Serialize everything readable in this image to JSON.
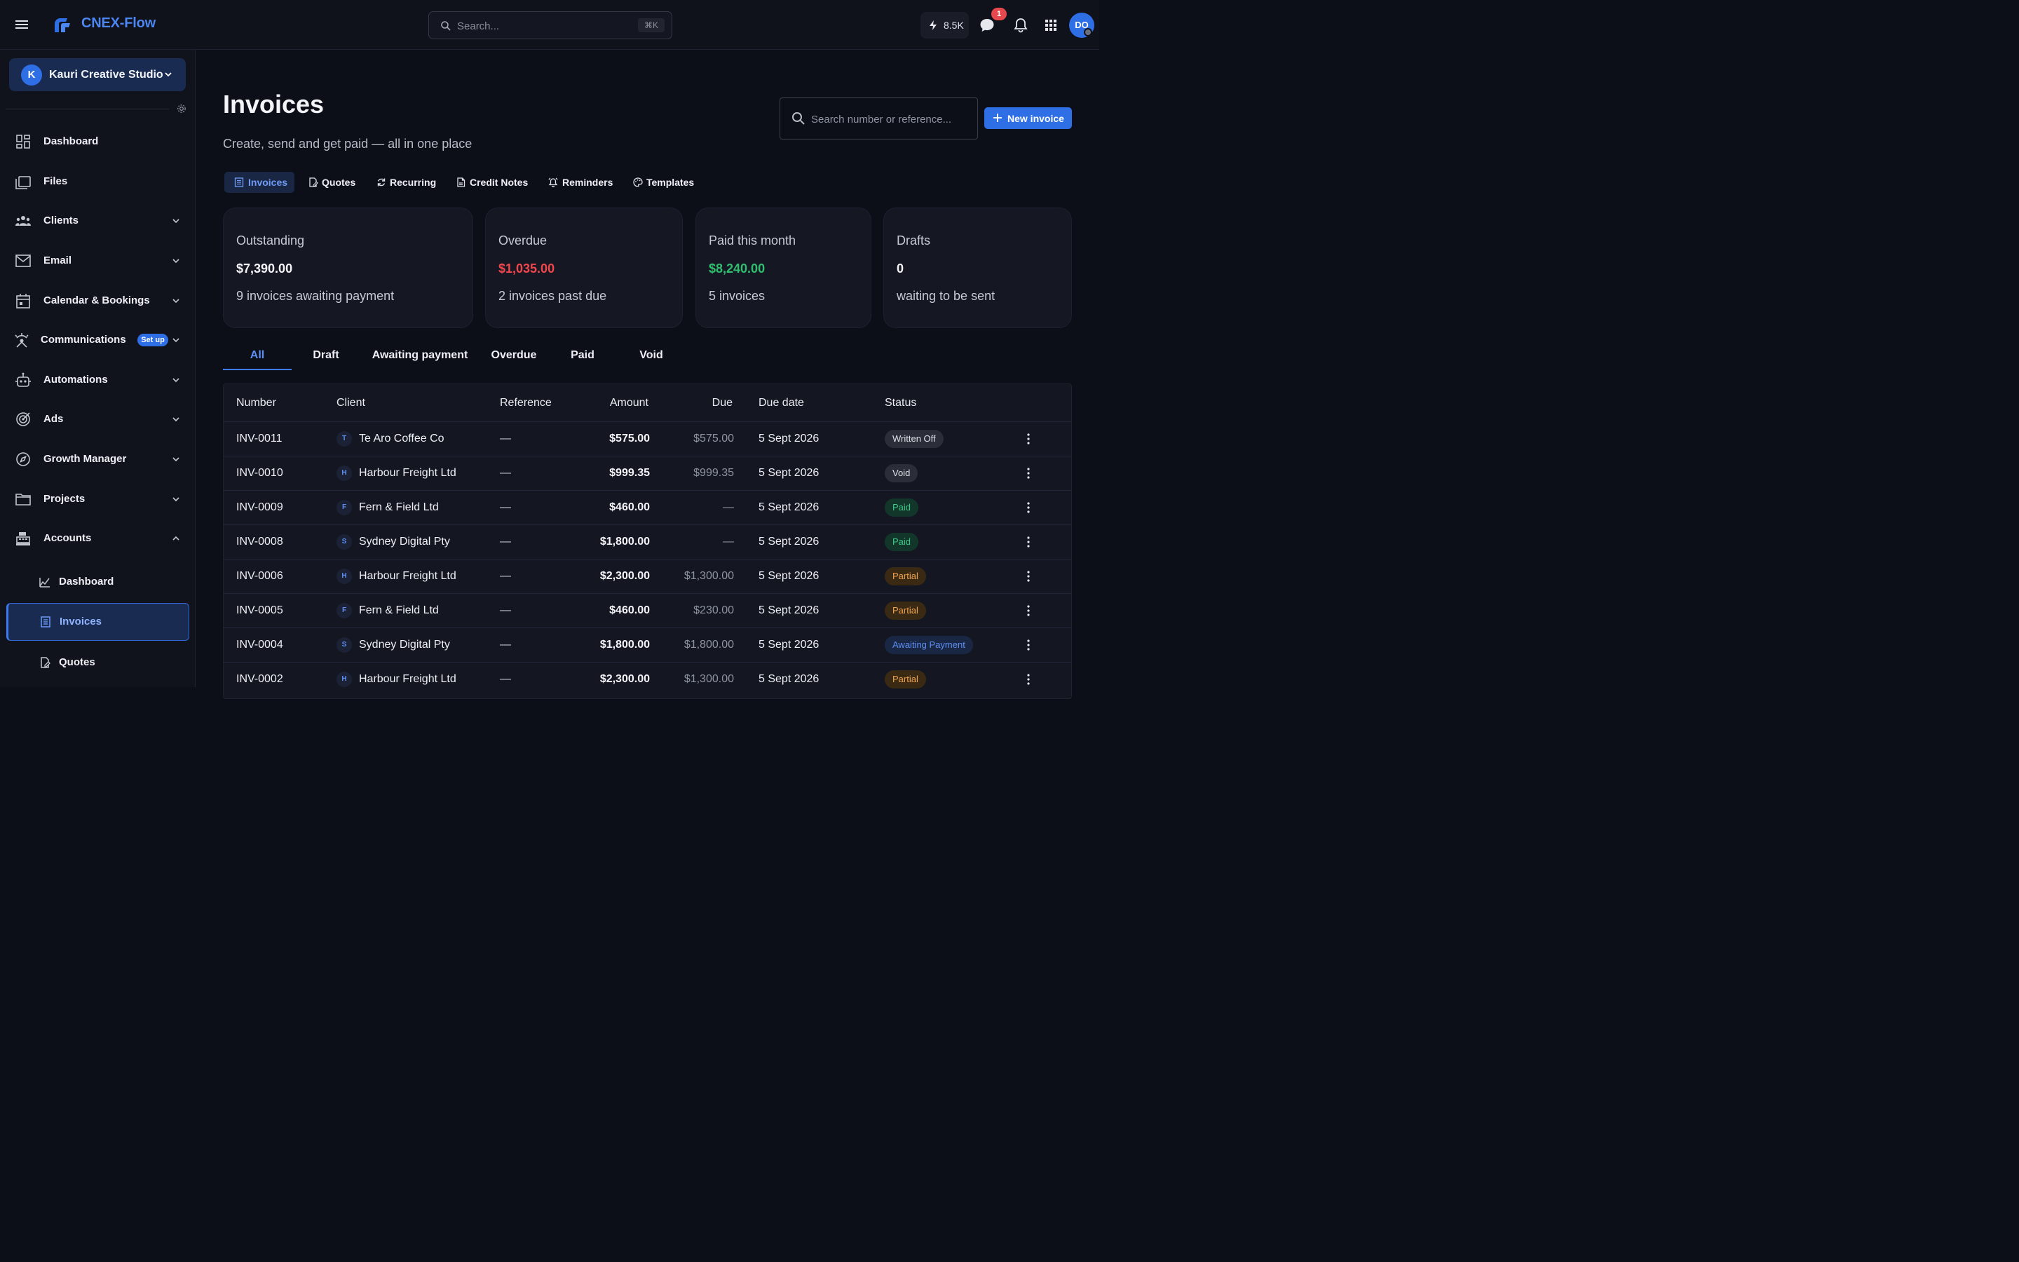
{
  "app": {
    "brand": "CNEX-Flow"
  },
  "topbar": {
    "search_placeholder": "Search...",
    "search_shortcut": "⌘K",
    "credits": "8.5K",
    "messages_badge": "1",
    "avatar_initials": "DO"
  },
  "sidebar": {
    "org_initial": "K",
    "org_name": "Kauri Creative Studio",
    "items": [
      {
        "label": "Dashboard",
        "icon": "dashboard-icon"
      },
      {
        "label": "Files",
        "icon": "files-icon"
      },
      {
        "label": "Clients",
        "icon": "clients-icon"
      },
      {
        "label": "Email",
        "icon": "email-icon"
      },
      {
        "label": "Calendar & Bookings",
        "icon": "calendar-icon"
      },
      {
        "label": "Communications",
        "icon": "communications-icon",
        "badge": "Set up"
      },
      {
        "label": "Automations",
        "icon": "robot-icon"
      },
      {
        "label": "Ads",
        "icon": "target-icon"
      },
      {
        "label": "Growth Manager",
        "icon": "compass-icon"
      },
      {
        "label": "Projects",
        "icon": "folder-icon"
      },
      {
        "label": "Accounts",
        "icon": "register-icon"
      }
    ],
    "sub_items": [
      {
        "label": "Dashboard",
        "icon": "chart-icon"
      },
      {
        "label": "Invoices",
        "icon": "invoice-icon"
      },
      {
        "label": "Quotes",
        "icon": "quote-icon"
      }
    ]
  },
  "page": {
    "title": "Invoices",
    "subtitle": "Create, send and get paid — all in one place",
    "search_placeholder": "Search number or reference...",
    "new_button": "New invoice"
  },
  "subnav": [
    "Invoices",
    "Quotes",
    "Recurring",
    "Credit Notes",
    "Reminders",
    "Templates"
  ],
  "stats": [
    {
      "title": "Outstanding",
      "value": "$7,390.00",
      "sub": "9 invoices awaiting payment",
      "color": "#f3f4f8"
    },
    {
      "title": "Overdue",
      "value": "$1,035.00",
      "sub": "2 invoices past due",
      "color": "#f0464c"
    },
    {
      "title": "Paid this month",
      "value": "$8,240.00",
      "sub": "5 invoices",
      "color": "#2fbf6e"
    },
    {
      "title": "Drafts",
      "value": "0",
      "sub": "waiting to be sent",
      "color": "#f3f4f8"
    }
  ],
  "filter_tabs": [
    "All",
    "Draft",
    "Awaiting payment",
    "Overdue",
    "Paid",
    "Void"
  ],
  "table": {
    "headers": [
      "Number",
      "Client",
      "Reference",
      "Amount",
      "Due",
      "Due date",
      "Status"
    ],
    "rows": [
      {
        "number": "INV-0011",
        "client_initial": "T",
        "client": "Te Aro Coffee Co",
        "reference": "—",
        "amount": "$575.00",
        "due": "$575.00",
        "due_date": "5 Sept 2026",
        "status": "Written Off",
        "status_style": "gray"
      },
      {
        "number": "INV-0010",
        "client_initial": "H",
        "client": "Harbour Freight Ltd",
        "reference": "—",
        "amount": "$999.35",
        "due": "$999.35",
        "due_date": "5 Sept 2026",
        "status": "Void",
        "status_style": "gray"
      },
      {
        "number": "INV-0009",
        "client_initial": "F",
        "client": "Fern & Field Ltd",
        "reference": "—",
        "amount": "$460.00",
        "due": "—",
        "due_date": "5 Sept 2026",
        "status": "Paid",
        "status_style": "green"
      },
      {
        "number": "INV-0008",
        "client_initial": "S",
        "client": "Sydney Digital Pty",
        "reference": "—",
        "amount": "$1,800.00",
        "due": "—",
        "due_date": "5 Sept 2026",
        "status": "Paid",
        "status_style": "green"
      },
      {
        "number": "INV-0006",
        "client_initial": "H",
        "client": "Harbour Freight Ltd",
        "reference": "—",
        "amount": "$2,300.00",
        "due": "$1,300.00",
        "due_date": "5 Sept 2026",
        "status": "Partial",
        "status_style": "orange"
      },
      {
        "number": "INV-0005",
        "client_initial": "F",
        "client": "Fern & Field Ltd",
        "reference": "—",
        "amount": "$460.00",
        "due": "$230.00",
        "due_date": "5 Sept 2026",
        "status": "Partial",
        "status_style": "orange"
      },
      {
        "number": "INV-0004",
        "client_initial": "S",
        "client": "Sydney Digital Pty",
        "reference": "—",
        "amount": "$1,800.00",
        "due": "$1,800.00",
        "due_date": "5 Sept 2026",
        "status": "Awaiting Payment",
        "status_style": "blue"
      },
      {
        "number": "INV-0002",
        "client_initial": "H",
        "client": "Harbour Freight Ltd",
        "reference": "—",
        "amount": "$2,300.00",
        "due": "$1,300.00",
        "due_date": "5 Sept 2026",
        "status": "Partial",
        "status_style": "orange"
      }
    ]
  }
}
